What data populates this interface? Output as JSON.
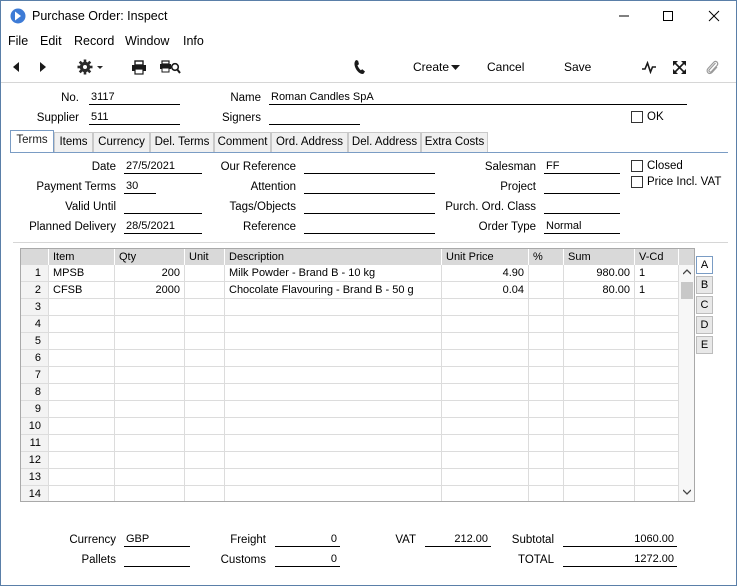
{
  "window": {
    "title": "Purchase Order: Inspect"
  },
  "menu": [
    "File",
    "Edit",
    "Record",
    "Window",
    "Info"
  ],
  "toolbar": {
    "create": "Create",
    "cancel": "Cancel",
    "save": "Save"
  },
  "header": {
    "no_label": "No.",
    "no_value": "3117",
    "supplier_label": "Supplier",
    "supplier_value": "511",
    "name_label": "Name",
    "name_value": "Roman Candles SpA",
    "signers_label": "Signers",
    "signers_value": "",
    "ok_label": "OK"
  },
  "tabs": [
    "Terms",
    "Items",
    "Currency",
    "Del. Terms",
    "Comment",
    "Ord. Address",
    "Del. Address",
    "Extra Costs"
  ],
  "terms": {
    "date_label": "Date",
    "date_value": "27/5/2021",
    "payment_terms_label": "Payment Terms",
    "payment_terms_value": "30",
    "valid_until_label": "Valid Until",
    "valid_until_value": "",
    "planned_delivery_label": "Planned Delivery",
    "planned_delivery_value": "28/5/2021",
    "our_reference_label": "Our Reference",
    "our_reference_value": "",
    "attention_label": "Attention",
    "attention_value": "",
    "tags_label": "Tags/Objects",
    "tags_value": "",
    "reference_label": "Reference",
    "reference_value": "",
    "salesman_label": "Salesman",
    "salesman_value": "FF",
    "project_label": "Project",
    "project_value": "",
    "purch_ord_class_label": "Purch. Ord. Class",
    "purch_ord_class_value": "",
    "order_type_label": "Order Type",
    "order_type_value": "Normal",
    "closed_label": "Closed",
    "price_incl_vat_label": "Price Incl. VAT"
  },
  "grid": {
    "columns": [
      "Item",
      "Qty",
      "Unit",
      "Description",
      "Unit Price",
      "%",
      "Sum",
      "V-Cd"
    ],
    "rows": [
      {
        "n": "1",
        "item": "MPSB",
        "qty": "200",
        "unit": "",
        "desc": "Milk Powder - Brand B - 10 kg",
        "price": "4.90",
        "pct": "",
        "sum": "980.00",
        "vcd": "1"
      },
      {
        "n": "2",
        "item": "CFSB",
        "qty": "2000",
        "unit": "",
        "desc": "Chocolate Flavouring - Brand B - 50 g",
        "price": "0.04",
        "pct": "",
        "sum": "80.00",
        "vcd": "1"
      },
      {
        "n": "3"
      },
      {
        "n": "4"
      },
      {
        "n": "5"
      },
      {
        "n": "6"
      },
      {
        "n": "7"
      },
      {
        "n": "8"
      },
      {
        "n": "9"
      },
      {
        "n": "10"
      },
      {
        "n": "11"
      },
      {
        "n": "12"
      },
      {
        "n": "13"
      },
      {
        "n": "14"
      }
    ]
  },
  "side_tabs": [
    "A",
    "B",
    "C",
    "D",
    "E"
  ],
  "footer": {
    "currency_label": "Currency",
    "currency_value": "GBP",
    "pallets_label": "Pallets",
    "pallets_value": "",
    "freight_label": "Freight",
    "freight_value": "0",
    "customs_label": "Customs",
    "customs_value": "0",
    "vat_label": "VAT",
    "vat_value": "212.00",
    "subtotal_label": "Subtotal",
    "subtotal_value": "1060.00",
    "total_label": "TOTAL",
    "total_value": "1272.00"
  },
  "colors": {
    "accent": "#3d7bd6",
    "tab_border": "#7a9cc4",
    "grid_header": "#d9d9d9"
  }
}
